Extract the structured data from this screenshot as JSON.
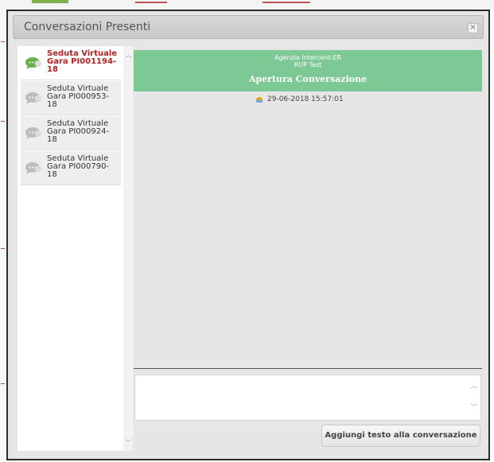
{
  "dialog": {
    "title": "Conversazioni Presenti",
    "close_icon": "close-icon"
  },
  "conversations": [
    {
      "label": "Seduta Virtuale Gara PI001194-18",
      "active": true,
      "icon": "chat-bubble-icon"
    },
    {
      "label": "Seduta Virtuale Gara PI000953-18",
      "active": false,
      "icon": "chat-bubble-icon"
    },
    {
      "label": "Seduta Virtuale Gara PI000924-18",
      "active": false,
      "icon": "chat-bubble-icon"
    },
    {
      "label": "Seduta Virtuale Gara PI000790-18",
      "active": false,
      "icon": "chat-bubble-icon"
    }
  ],
  "message": {
    "organization": "Agenzia Intercent-ER",
    "user": "RUP Test",
    "event": "Apertura Conversazione",
    "timestamp": "29-06-2018 15:57:01"
  },
  "composer": {
    "value": "",
    "button_label": "Aggiungi testo alla conversazione"
  },
  "colors": {
    "accent_green": "#7cc996",
    "active_red": "#b22222",
    "active_bubble": "#6ab04c",
    "inactive_bubble": "#bdbdbd"
  }
}
